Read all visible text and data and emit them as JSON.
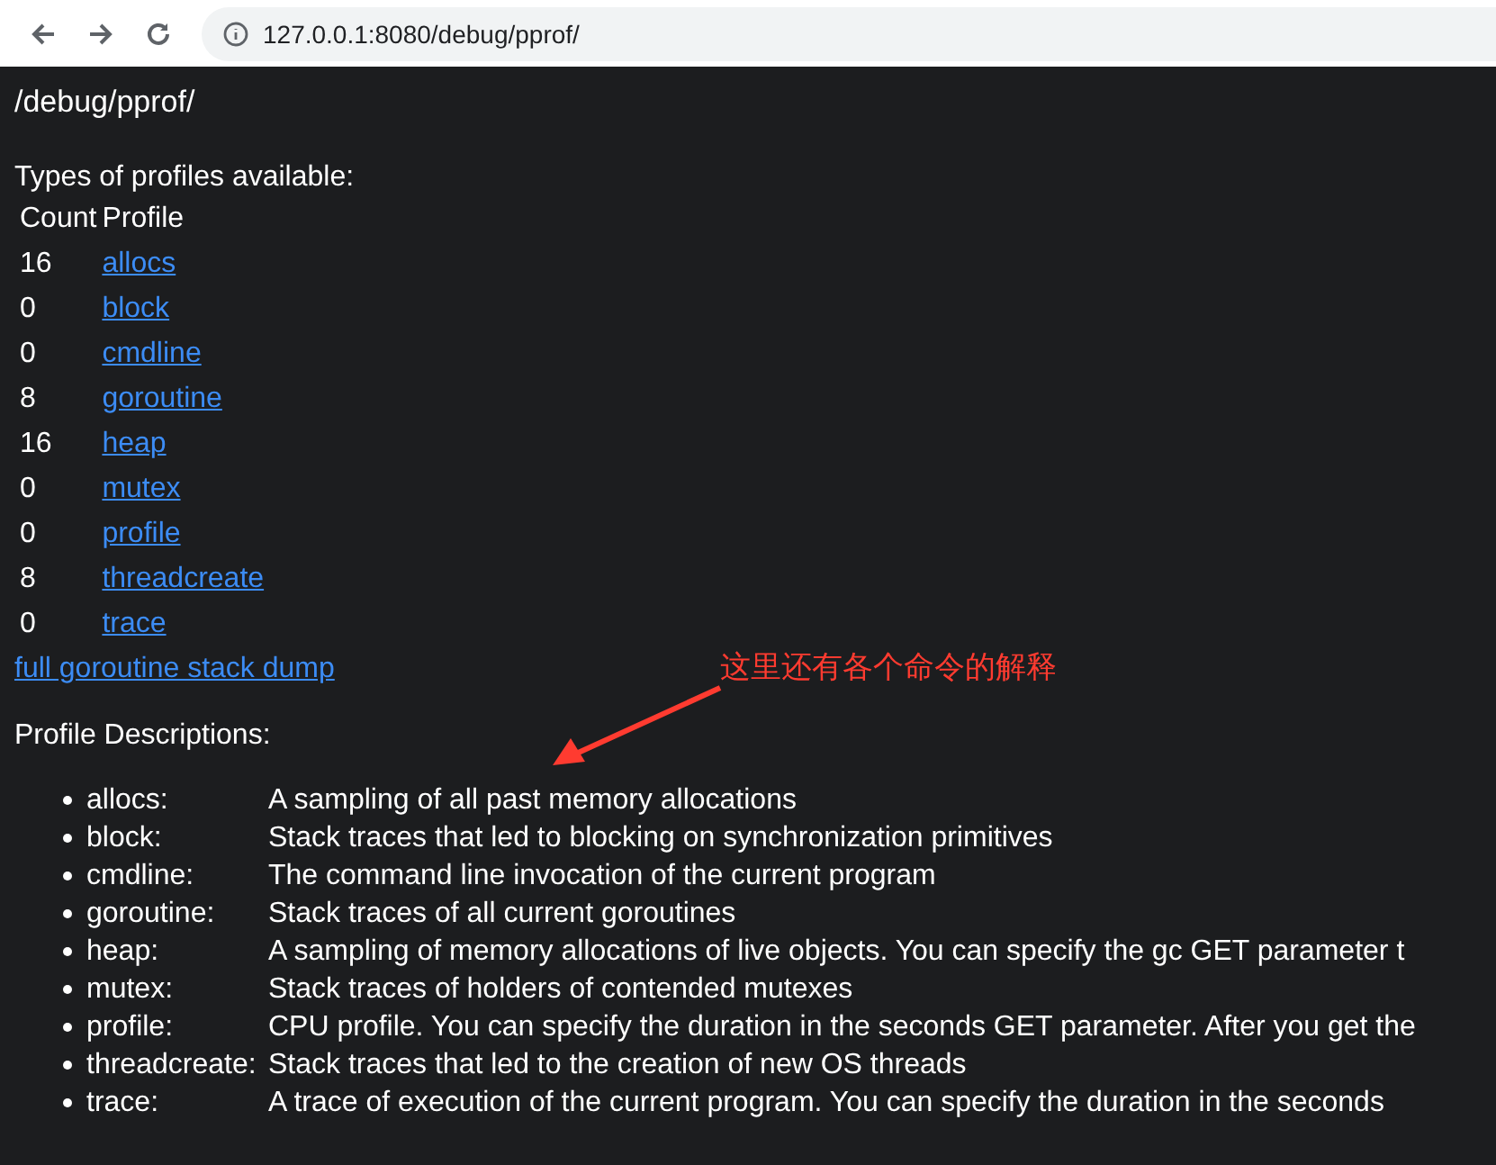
{
  "browser": {
    "url": "127.0.0.1:8080/debug/pprof/"
  },
  "page": {
    "title": "/debug/pprof/",
    "intro": "Types of profiles available:",
    "table": {
      "columns": [
        "Count",
        "Profile"
      ],
      "rows": [
        {
          "count": "16",
          "profile": "allocs"
        },
        {
          "count": "0",
          "profile": "block"
        },
        {
          "count": "0",
          "profile": "cmdline"
        },
        {
          "count": "8",
          "profile": "goroutine"
        },
        {
          "count": "16",
          "profile": "heap"
        },
        {
          "count": "0",
          "profile": "mutex"
        },
        {
          "count": "0",
          "profile": "profile"
        },
        {
          "count": "8",
          "profile": "threadcreate"
        },
        {
          "count": "0",
          "profile": "trace"
        }
      ]
    },
    "dump_link": "full goroutine stack dump",
    "descriptions_heading": "Profile Descriptions:",
    "descriptions": [
      {
        "name": "allocs:",
        "text": "A sampling of all past memory allocations"
      },
      {
        "name": "block:",
        "text": "Stack traces that led to blocking on synchronization primitives"
      },
      {
        "name": "cmdline:",
        "text": "The command line invocation of the current program"
      },
      {
        "name": "goroutine:",
        "text": "Stack traces of all current goroutines"
      },
      {
        "name": "heap:",
        "text": "A sampling of memory allocations of live objects. You can specify the gc GET parameter t"
      },
      {
        "name": "mutex:",
        "text": "Stack traces of holders of contended mutexes"
      },
      {
        "name": "profile:",
        "text": "CPU profile. You can specify the duration in the seconds GET parameter. After you get the"
      },
      {
        "name": "threadcreate:",
        "text": "Stack traces that led to the creation of new OS threads"
      },
      {
        "name": "trace:",
        "text": "A trace of execution of the current program. You can specify the duration in the seconds"
      }
    ]
  },
  "annotation": {
    "text": "这里还有各个命令的解释"
  }
}
